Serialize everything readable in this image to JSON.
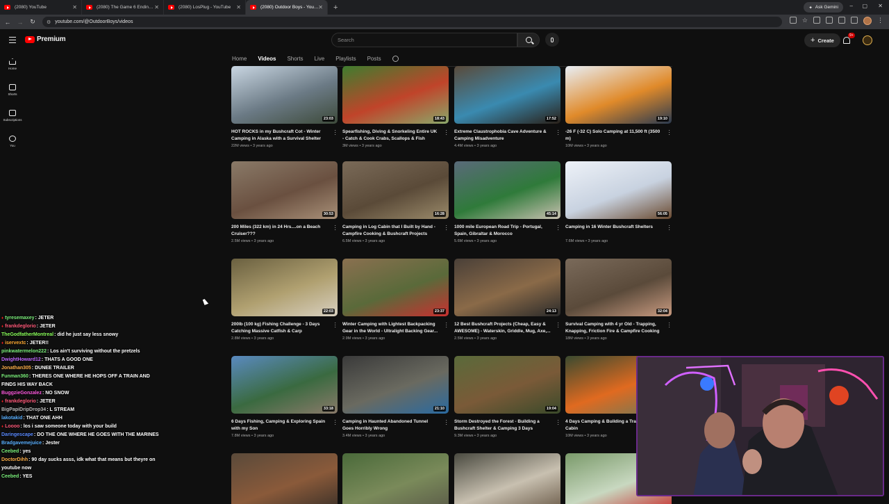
{
  "browser": {
    "tabs": [
      {
        "label": "(2080) YouTube",
        "active": false
      },
      {
        "label": "(2080) The Game 6 Ending No...",
        "active": false
      },
      {
        "label": "(2080) LosPlug - YouTube",
        "active": false
      },
      {
        "label": "(2080) Outdoor Boys - YouTube",
        "active": true
      }
    ],
    "ask_gemini": "Ask Gemini",
    "url": "youtube.com/@OutdoorBoys/videos"
  },
  "masthead": {
    "logo": "Premium",
    "search_placeholder": "Search",
    "create": "Create",
    "notif_badge": "9+"
  },
  "guide": [
    {
      "label": "Home",
      "icon": "home-icon"
    },
    {
      "label": "Shorts",
      "icon": "shorts-icon"
    },
    {
      "label": "Subscriptions",
      "icon": "subscriptions-icon"
    },
    {
      "label": "You",
      "icon": "you-icon"
    }
  ],
  "channel_tabs": [
    "Home",
    "Videos",
    "Shorts",
    "Live",
    "Playlists",
    "Posts"
  ],
  "selected_tab": "Videos",
  "videos": [
    {
      "title": "HOT ROCKS in my Bushcraft Cot - Winter Camping in Alaska with a Survival Shelter",
      "views": "22M views",
      "age": "3 years ago",
      "duration": "23:03",
      "colors": [
        "#c9d6e2",
        "#6b7a85",
        "#3d4a3a"
      ]
    },
    {
      "title": "Spearfishing, Diving & Snorkeling Entire UK - Catch & Cook Crabs, Scallops & Fish",
      "views": "3M views",
      "age": "3 years ago",
      "duration": "18:43",
      "colors": [
        "#3e7d2f",
        "#c0442a",
        "#8aa86a"
      ]
    },
    {
      "title": "Extreme Claustrophobia Cave Adventure & Camping Misadventure",
      "views": "4.4M views",
      "age": "3 years ago",
      "duration": "17:52",
      "colors": [
        "#5a4a3a",
        "#3a8ab0",
        "#2a2018"
      ]
    },
    {
      "title": "-26 F (-32 C) Solo Camping at 11,500 ft (3500 m)",
      "views": "10M views",
      "age": "3 years ago",
      "duration": "19:10",
      "colors": [
        "#e8eef5",
        "#e08a2a",
        "#2a3a50"
      ]
    },
    {
      "title": "200 Miles (322 km) in 24 Hrs....on a Beach Cruiser???",
      "views": "2.5M views",
      "age": "3 years ago",
      "duration": "30:53",
      "colors": [
        "#8a7a68",
        "#6a5040",
        "#a89078"
      ]
    },
    {
      "title": "Camping in Log Cabin that I Built by Hand - Campfire Cooking & Bushcraft Projects",
      "views": "6.5M views",
      "age": "3 years ago",
      "duration": "16:28",
      "colors": [
        "#7a6a58",
        "#5a4a38",
        "#9a8a6a"
      ]
    },
    {
      "title": "1000 mile European Road Trip - Portugal, Spain, Gibraltar & Morocco",
      "views": "5.6M views",
      "age": "3 years ago",
      "duration": "45:14",
      "colors": [
        "#5a6a7a",
        "#2f7a3a",
        "#c8c0b0"
      ]
    },
    {
      "title": "Camping in 16 Winter Bushcraft Shelters",
      "views": "7.6M views",
      "age": "3 years ago",
      "duration": "56:05",
      "colors": [
        "#eef2f8",
        "#c8d2e0",
        "#6a4a30"
      ]
    },
    {
      "title": "200lb (100 kg) Fishing Challenge - 3 Days Catching Massive Catfish & Carp",
      "views": "2.8M views",
      "age": "3 years ago",
      "duration": "22:03",
      "colors": [
        "#6a6040",
        "#b0a070",
        "#d8d0c0"
      ]
    },
    {
      "title": "Winter Camping with Lightest Backpacking Gear in the World - Ultralight Backing Gear...",
      "views": "2.9M views",
      "age": "3 years ago",
      "duration": "23:37",
      "colors": [
        "#8a7050",
        "#5a6a3a",
        "#c83030"
      ]
    },
    {
      "title": "12 Best Bushcraft Projects (Cheap, Easy & AWESOME) - Waterskin, Griddle, Mug, Axe,...",
      "views": "2.5M views",
      "age": "3 years ago",
      "duration": "24:13",
      "colors": [
        "#4a4038",
        "#8a6a48",
        "#2a2a2a"
      ]
    },
    {
      "title": "Survival Camping with 4 yr Old - Trapping, Knapping, Friction Fire & Campfire Cooking",
      "views": "18M views",
      "age": "3 years ago",
      "duration": "32:04",
      "colors": [
        "#7a6a5a",
        "#5a4a3a",
        "#c89a80"
      ]
    },
    {
      "title": "6 Days Fishing, Camping & Exploring Spain with my Son",
      "views": "7.8M views",
      "age": "3 years ago",
      "duration": "33:18",
      "colors": [
        "#5a8ac0",
        "#3a6a40",
        "#8a7a6a"
      ]
    },
    {
      "title": "Camping in Haunted Abandoned Tunnel Goes Horribly Wrong",
      "views": "3.4M views",
      "age": "3 years ago",
      "duration": "21:10",
      "colors": [
        "#3a3a3a",
        "#6a6a60",
        "#2a6aa0"
      ]
    },
    {
      "title": "Storm Destroyed the Forest - Building a Bushcraft Shelter & Camping 3 Days",
      "views": "9.3M views",
      "age": "3 years ago",
      "duration": "19:04",
      "colors": [
        "#5a6a3a",
        "#7a5a38",
        "#3a4a2a"
      ]
    },
    {
      "title": "4 Days Camping & Building a Trapper's Cabin",
      "views": "10M views",
      "age": "3 years ago",
      "duration": "",
      "colors": [
        "#3a4a30",
        "#e06a20",
        "#6a7a5a"
      ]
    },
    {
      "title": "",
      "views": "",
      "age": "",
      "duration": "",
      "colors": [
        "#5a4a3a",
        "#8a5a3a",
        "#3a3028"
      ]
    },
    {
      "title": "",
      "views": "",
      "age": "",
      "duration": "",
      "colors": [
        "#4a6a3a",
        "#7a8a5a",
        "#5a5a48"
      ]
    },
    {
      "title": "",
      "views": "",
      "age": "",
      "duration": "",
      "colors": [
        "#4a4a40",
        "#c8c0b0",
        "#6a5a48"
      ]
    },
    {
      "title": "",
      "views": "",
      "age": "",
      "duration": "",
      "colors": [
        "#7a9a6a",
        "#c8d8c0",
        "#c83030"
      ]
    }
  ],
  "chat": [
    {
      "user": "tyresemaxey",
      "color": "#7cf07c",
      "heart": true,
      "text": "JETER"
    },
    {
      "user": "frankdeglorio",
      "color": "#ff5a7a",
      "heart": true,
      "text": "JETER"
    },
    {
      "user": "TheGodfatherMontreal",
      "color": "#8aff5a",
      "heart": false,
      "text": "did he just say less snowy"
    },
    {
      "user": "iservextc",
      "color": "#ffaa33",
      "heart": true,
      "text": "JETER!!"
    },
    {
      "user": "pinkwatermelon222",
      "color": "#7cf07c",
      "heart": false,
      "text": "Los ain't surviving without the pretzels"
    },
    {
      "user": "DwightHoward12",
      "color": "#c06aff",
      "heart": false,
      "text": "THATS A GOOD ONE"
    },
    {
      "user": "Jonathan305",
      "color": "#ffb04a",
      "heart": false,
      "text": "DUNEE TRAILER"
    },
    {
      "user": "Funman360",
      "color": "#7cf07c",
      "heart": false,
      "text": "THERES ONE WHERE HE HOPS OFF A TRAIN AND FINDS HIS WAY BACK"
    },
    {
      "user": "BuggzieGonzalez",
      "color": "#ff5ae0",
      "heart": false,
      "text": "NO SNOW"
    },
    {
      "user": "frankdeglorio",
      "color": "#ff5a7a",
      "heart": true,
      "text": "JETER"
    },
    {
      "user": "BigPapiDripDrop34",
      "color": "#bbbbbb",
      "heart": false,
      "text": "L STREAM"
    },
    {
      "user": "lakotakid",
      "color": "#5ab0ff",
      "heart": false,
      "text": "THAT ONE AHH"
    },
    {
      "user": "Loooo",
      "color": "#ff5a7a",
      "heart": true,
      "text": "los i saw someone today with your build"
    },
    {
      "user": "Daringescape",
      "color": "#5a8aff",
      "heart": false,
      "text": "DO THE ONE WHERE HE GOES WITH THE MARINES"
    },
    {
      "user": "Bradgavemejuice",
      "color": "#5ab0ff",
      "heart": false,
      "text": "Jester"
    },
    {
      "user": "Ceebed",
      "color": "#7cf07c",
      "heart": false,
      "text": "yes"
    },
    {
      "user": "DoctorDihh",
      "color": "#ffb04a",
      "heart": false,
      "text": "90 day sucks asss, idk what that means but theyre on youtube now"
    },
    {
      "user": "Ceebed",
      "color": "#7cf07c",
      "heart": false,
      "text": "YES"
    }
  ]
}
